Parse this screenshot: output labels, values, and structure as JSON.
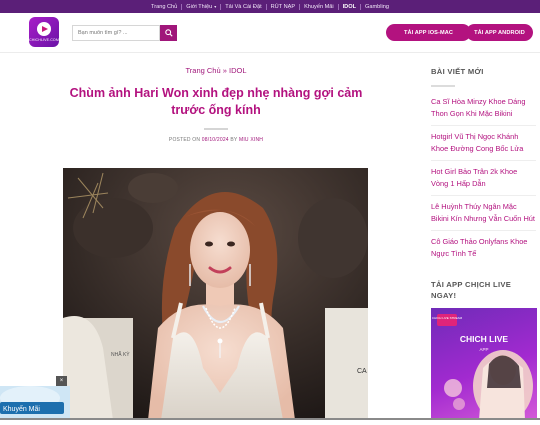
{
  "topnav": {
    "items": [
      {
        "label": "Trang Chủ"
      },
      {
        "label": "Giới Thiệu",
        "caret": "▾"
      },
      {
        "label": "Tải Và Cài Đặt"
      },
      {
        "label": "RÚT NẠP"
      },
      {
        "label": "Khuyến Mãi"
      },
      {
        "label": "IDOL",
        "active": true
      },
      {
        "label": "Gambling"
      }
    ]
  },
  "header": {
    "logo_text": "CHICHLIVE.COM",
    "search": {
      "placeholder": "Bạn muốn tìm gì? ..."
    },
    "buttons": {
      "ios": "TẢI APP IOS-MAC",
      "android": "TẢI APP ANDROID"
    }
  },
  "main": {
    "breadcrumb": {
      "home": "Trang Chủ",
      "separator": "»",
      "current": "IDOL"
    },
    "title": "Chùm ảnh Hari Won xinh đẹp nhẹ nhàng gợi cảm trước ống kính",
    "meta": {
      "posted_on": "POSTED ON",
      "date": "08/10/2024",
      "by": "BY",
      "author": "MIU XINH"
    }
  },
  "sidebar": {
    "recent_heading": "BÀI VIẾT MỚI",
    "posts": [
      "Ca Sĩ Hòa Minzy Khoe Dáng Thon Gọn Khi Mặc Bikini",
      "Hotgirl Vũ Thị Ngọc Khánh Khoe Đường Cong Bốc Lửa",
      "Hot Girl Bảo Trân 2k Khoe Vòng 1 Hấp Dẫn",
      "Lê Huỳnh Thúy Ngân Mặc Bikini Kín Nhưng Vẫn Cuốn Hút",
      "Cô Giáo Thảo Onlyfans Khoe Ngực Tình Tế"
    ],
    "app_heading": "TẢI APP CHỊCH LIVE NGAY!",
    "promo": {
      "badge": "CHICH LIVE STREAM",
      "brand": "CHICH LIVE",
      "sub": "APP"
    }
  },
  "float_promo": {
    "label": "Khuyến Mãi",
    "close": "×"
  },
  "colors": {
    "nav_bg": "#5b1f78",
    "accent": "#b3127f",
    "link": "#a0167a"
  }
}
